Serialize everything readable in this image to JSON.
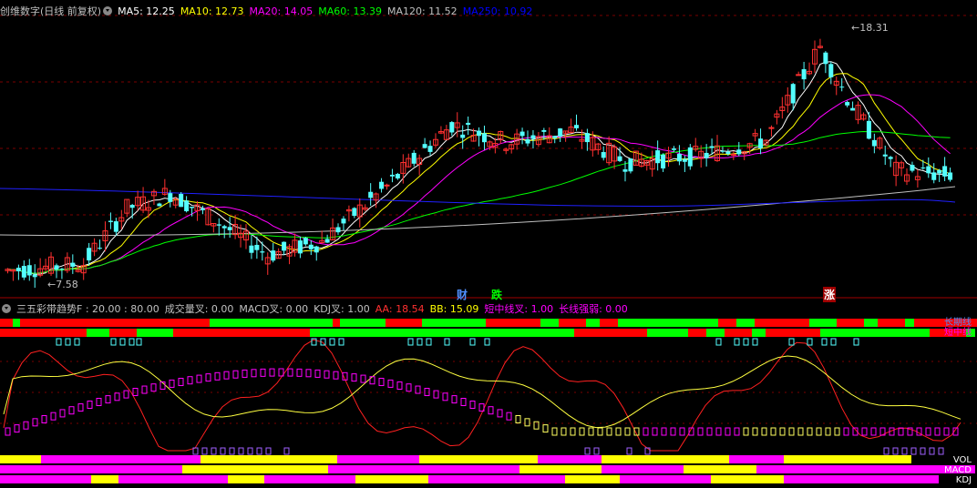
{
  "main_header": {
    "title": "创维数字(日线 前复权)",
    "ma": [
      {
        "label": "MA5: 12.25",
        "color": "#ffffff"
      },
      {
        "label": "MA10: 12.73",
        "color": "#ffff00"
      },
      {
        "label": "MA20: 14.05",
        "color": "#ff00ff"
      },
      {
        "label": "MA60: 13.39",
        "color": "#00ff00"
      },
      {
        "label": "MA120: 11.52",
        "color": "#c0c0c0"
      },
      {
        "label": "MA250: 10.92",
        "color": "#0000ff"
      }
    ]
  },
  "annotations": {
    "high": "18.31",
    "low": "7.58"
  },
  "event_tags": [
    {
      "text": "财",
      "color": "#4f8fff",
      "bg": "#000"
    },
    {
      "text": "跌",
      "color": "#00ff00",
      "bg": "#000"
    },
    {
      "text": "涨",
      "color": "#ffffff",
      "bg": "#a00000"
    }
  ],
  "indicator_header": [
    {
      "label": "三五彩带趋势F : 20.00 : 80.00",
      "color": "#c0c0c0"
    },
    {
      "label": "成交量叉: 0.00",
      "color": "#c0c0c0"
    },
    {
      "label": "MACD叉: 0.00",
      "color": "#c0c0c0"
    },
    {
      "label": "KDJ叉: 1.00",
      "color": "#c0c0c0"
    },
    {
      "label": "AA: 18.54",
      "color": "#ff3030"
    },
    {
      "label": "BB: 15.09",
      "color": "#ffff00"
    },
    {
      "label": "短中线叉: 1.00",
      "color": "#ff00ff"
    },
    {
      "label": "长线强弱: 0.00",
      "color": "#ff00ff"
    }
  ],
  "band_labels": {
    "top1": "长期线",
    "top2": "短中线",
    "b1": "VOL",
    "b2": "MACD",
    "b3": "KDJ"
  },
  "colors": {
    "up": "#ff3030",
    "down": "#54ffff",
    "bull": "#ff0000",
    "bear": "#00ff00",
    "magenta": "#ff00ff",
    "yellow": "#ffff00"
  }
}
